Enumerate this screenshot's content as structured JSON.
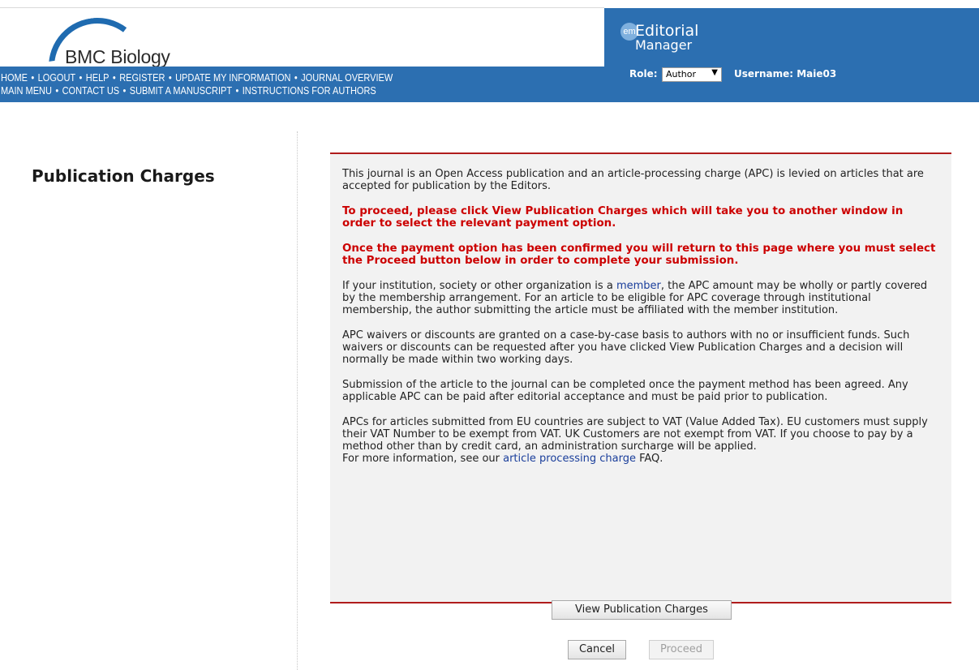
{
  "header": {
    "journal_name": "BMC Biology",
    "em_badge": "em",
    "em_title_line1": "Editorial",
    "em_title_line2": "Manager",
    "nav_row1": [
      "HOME",
      "LOGOUT",
      "HELP",
      "REGISTER",
      "UPDATE MY INFORMATION",
      "JOURNAL OVERVIEW"
    ],
    "nav_row2": [
      "MAIN MENU",
      "CONTACT US",
      "SUBMIT A MANUSCRIPT",
      "INSTRUCTIONS FOR AUTHORS"
    ],
    "separator": "•",
    "role_label": "Role:",
    "role_value": "Author",
    "role_arrow": "▼",
    "username_label": "Username: Maie03"
  },
  "page": {
    "title": "Publication Charges"
  },
  "content": {
    "p1": "This journal is an Open Access publication and an article-processing charge (APC) is levied on articles that are accepted for publication by the Editors.",
    "p2_red": "To proceed, please click View Publication Charges which will take you to another window in order to select the relevant payment option.",
    "p3_red": "Once the payment option has been confirmed you will return to this page where you must select the Proceed button below in order to complete your submission.",
    "p4_a": "If your institution, society or other organization is a ",
    "p4_link": "member",
    "p4_b": ", the APC amount may be wholly or partly covered by the membership arrangement. For an article to be eligible for APC coverage through institutional membership, the author submitting the article must be affiliated with the member institution.",
    "p5": "APC waivers or discounts are granted on a case-by-case basis to authors with no or insufficient funds. Such waivers or discounts can be requested after you have clicked View Publication Charges and a decision will normally be made within two working days.",
    "p6": "Submission of the article to the journal can be completed once the payment method has been agreed. Any applicable APC can be paid after editorial acceptance and must be paid prior to publication.",
    "p7": "APCs for articles submitted from EU countries are subject to VAT (Value Added Tax). EU customers must supply their VAT Number to be exempt from VAT. UK Customers are not exempt from VAT. If you choose to pay by a method other than by credit card, an administration surcharge will be applied.",
    "p8_a": "For more information, see our ",
    "p8_link": "article processing charge",
    "p8_b": " FAQ."
  },
  "buttons": {
    "view": "View Publication Charges",
    "cancel": "Cancel",
    "proceed": "Proceed"
  }
}
